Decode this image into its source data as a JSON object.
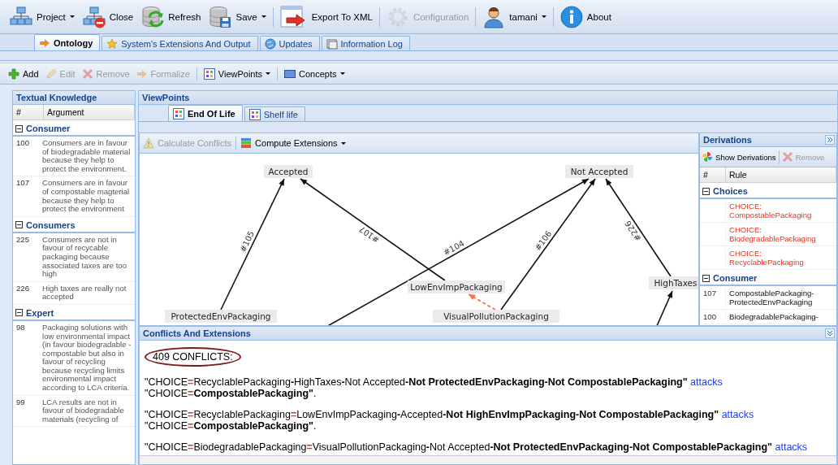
{
  "toolbar": [
    {
      "label": "Project",
      "menu": true,
      "disabled": false
    },
    {
      "label": "Close",
      "menu": false,
      "disabled": false
    },
    {
      "label": "Refresh",
      "menu": false,
      "disabled": false
    },
    {
      "label": "Save",
      "menu": true,
      "disabled": false
    },
    {
      "label": "Export To XML",
      "menu": false,
      "disabled": false
    },
    {
      "label": "Configuration",
      "menu": false,
      "disabled": true
    },
    {
      "label": "tamani",
      "menu": true,
      "disabled": false
    },
    {
      "label": "About",
      "menu": false,
      "disabled": false
    }
  ],
  "tabs": [
    {
      "label": "Ontology",
      "selected": true
    },
    {
      "label": "System's Extensions And Output",
      "selected": false
    },
    {
      "label": "Updates",
      "selected": false
    },
    {
      "label": "Information Log",
      "selected": false
    }
  ],
  "actions": [
    {
      "label": "Add",
      "menu": false,
      "disabled": false
    },
    {
      "label": "Edit",
      "menu": false,
      "disabled": true
    },
    {
      "label": "Remove",
      "menu": false,
      "disabled": true
    },
    {
      "label": "Formalize",
      "menu": false,
      "disabled": true
    },
    {
      "label": "ViewPoints",
      "menu": true,
      "disabled": false
    },
    {
      "label": "Concepts",
      "menu": true,
      "disabled": false
    }
  ],
  "textual_knowledge": {
    "title": "Textual Knowledge",
    "columns": [
      "#",
      "Argument"
    ],
    "groups": [
      {
        "name": "Consumer",
        "expanded": true,
        "rows": [
          {
            "id": "100",
            "text": "Consumers are in favour of biodegradable material because they help to protect the environment."
          },
          {
            "id": "107",
            "text": "Consumers are in favour of compostable magterial because they help to protect the environment"
          }
        ]
      },
      {
        "name": "Consumers",
        "expanded": true,
        "rows": [
          {
            "id": "225",
            "text": "Consumers are not in favour of recycable packaging because associated taxes are too high"
          },
          {
            "id": "226",
            "text": "High taxes are really not accepted"
          }
        ]
      },
      {
        "name": "Expert",
        "expanded": true,
        "rows": [
          {
            "id": "98",
            "text": "Packaging solutions with low environmental impact (in favour biodegradable - compostable but also in favour of recycling because recycling limits environmental impact according to LCA criteria."
          },
          {
            "id": "99",
            "text": "LCA results are not in favour of biodegradable materials (recycling of"
          }
        ]
      }
    ]
  },
  "viewpoints": {
    "title": "ViewPoints",
    "tabs": [
      {
        "label": "End Of Life",
        "selected": true
      },
      {
        "label": "Shelf life",
        "selected": false
      }
    ],
    "toolbar": [
      {
        "label": "Calculate Conflicts",
        "menu": false,
        "disabled": true
      },
      {
        "label": "Compute Extensions",
        "menu": true,
        "disabled": false
      }
    ],
    "graph": {
      "nodes": [
        "Accepted",
        "Not Accepted",
        "LowEnvImpPackaging",
        "HighTaxes",
        "ProtectedEnvPackaging",
        "VisualPollutionPackaging"
      ],
      "edges": [
        {
          "label": "#105",
          "kind": "attack"
        },
        {
          "label": "#107",
          "kind": "attack"
        },
        {
          "label": "#104",
          "kind": "attack"
        },
        {
          "label": "#106",
          "kind": "attack"
        },
        {
          "label": "#226",
          "kind": "attack"
        },
        {
          "kind": "attack"
        },
        {
          "kind": "conflict"
        }
      ]
    }
  },
  "derivations": {
    "title": "Derivations",
    "toolbar": [
      {
        "label": "Show Derivations",
        "disabled": false
      },
      {
        "label": "Remove",
        "disabled": true
      }
    ],
    "columns": [
      "#",
      "Rule"
    ],
    "groups": [
      {
        "name": "Choices",
        "expanded": true,
        "rows": [
          {
            "kind": "choice",
            "text": "CHOICE: CompostablePackaging"
          },
          {
            "kind": "choice",
            "text": "CHOICE: BiodegradablePackaging"
          },
          {
            "kind": "choice",
            "text": "CHOICE: RecyclablePackaging"
          }
        ]
      },
      {
        "name": "Consumer",
        "expanded": true,
        "rows": [
          {
            "kind": "rule",
            "id": "107",
            "text": "CompostablePackaging-ProtectedEnvPackaging"
          },
          {
            "kind": "rule",
            "id": "100",
            "text": "BiodegradablePackaging-"
          }
        ]
      }
    ]
  },
  "conflicts": {
    "title": "Conflicts And Extensions",
    "count": "409 CONFLICTS:",
    "items": [
      {
        "claim": [
          {
            "kind": "plain",
            "text": "\"CHOICE"
          },
          {
            "kind": "red",
            "text": "="
          },
          {
            "kind": "plain",
            "text": "RecyclablePackaging"
          },
          {
            "kind": "bold",
            "text": "-"
          },
          {
            "kind": "plain",
            "text": "HighTaxes"
          },
          {
            "kind": "bold",
            "text": "-"
          },
          {
            "kind": "plain",
            "text": "Not Accepted"
          },
          {
            "kind": "bold",
            "text": "-Not ProtectedEnvPackaging-Not CompostablePackaging\""
          }
        ],
        "link": "attacks",
        "target": [
          {
            "kind": "plain",
            "text": "\"CHOICE"
          },
          {
            "kind": "red",
            "text": "="
          },
          {
            "kind": "bold",
            "text": "CompostablePackaging\""
          },
          {
            "kind": "plain",
            "text": "."
          }
        ]
      },
      {
        "claim": [
          {
            "kind": "plain",
            "text": "\"CHOICE"
          },
          {
            "kind": "red",
            "text": "="
          },
          {
            "kind": "plain",
            "text": "RecyclablePackaging"
          },
          {
            "kind": "red",
            "text": "="
          },
          {
            "kind": "plain",
            "text": "LowEnvImpPackaging"
          },
          {
            "kind": "bold",
            "text": "-"
          },
          {
            "kind": "plain",
            "text": "Accepted"
          },
          {
            "kind": "bold",
            "text": "-Not HighEnvImpPackaging-Not CompostablePackaging\""
          }
        ],
        "link": "attacks",
        "target": [
          {
            "kind": "plain",
            "text": "\"CHOICE"
          },
          {
            "kind": "red",
            "text": "="
          },
          {
            "kind": "bold",
            "text": "CompostablePackaging\""
          },
          {
            "kind": "plain",
            "text": "."
          }
        ]
      },
      {
        "claim": [
          {
            "kind": "plain",
            "text": "\"CHOICE"
          },
          {
            "kind": "red",
            "text": "="
          },
          {
            "kind": "plain",
            "text": "BiodegradablePackaging"
          },
          {
            "kind": "red",
            "text": "="
          },
          {
            "kind": "plain",
            "text": "VisualPollutionPackaging"
          },
          {
            "kind": "bold",
            "text": "-"
          },
          {
            "kind": "plain",
            "text": "Not Accepted"
          },
          {
            "kind": "bold",
            "text": "-Not ProtectedEnvPackaging-Not CompostablePackaging\""
          }
        ],
        "link": "attacks"
      }
    ]
  }
}
